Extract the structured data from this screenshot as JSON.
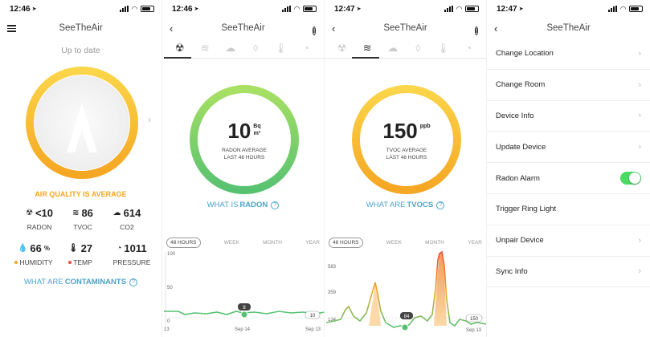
{
  "screen1": {
    "time": "12:46",
    "title": "SeeTheAir",
    "status_text": "Up to date",
    "air_quality_text": "AIR QUALITY IS AVERAGE",
    "metrics": [
      {
        "value": "<10",
        "unit": "",
        "label": "RADON"
      },
      {
        "value": "86",
        "unit": "",
        "label": "TVOC"
      },
      {
        "value": "614",
        "unit": "",
        "label": "CO2"
      },
      {
        "value": "66",
        "unit": "%",
        "label": "HUMIDITY"
      },
      {
        "value": "27",
        "unit": "",
        "label": "TEMP"
      },
      {
        "value": "1011",
        "unit": "",
        "label": "PRESSURE"
      }
    ],
    "what_are_prefix": "WHAT ARE",
    "what_are_bold": "CONTAMINANTS",
    "colors": {
      "accent": "#f5a623",
      "link": "#4aa3c9",
      "humidity_dot": "#f5a623",
      "temp_dot": "#e74c3c"
    }
  },
  "screen2": {
    "time": "12:46",
    "title": "SeeTheAir",
    "value": "10",
    "unit_top": "Bq",
    "unit_bottom": "m³",
    "sub1": "RADON AVERAGE",
    "sub2": "LAST 48 HOURS",
    "what_prefix": "WHAT IS",
    "what_bold": "RADON",
    "range_tabs": [
      "48 HOURS",
      "WEEK",
      "MONTH",
      "YEAR"
    ],
    "y_labels": [
      "100",
      "50",
      "0"
    ],
    "x_labels": [
      "13",
      "Sep 14",
      "Sep 13"
    ],
    "point_label_1": "8",
    "point_label_2": "10",
    "gauge_colors": [
      "#a8e063",
      "#56c271"
    ]
  },
  "screen3": {
    "time": "12:47",
    "title": "SeeTheAir",
    "value": "150",
    "unit_top": "ppb",
    "sub1": "TVOC AVERAGE",
    "sub2": "LAST 48 HOURS",
    "what_prefix": "WHAT ARE",
    "what_bold": "TVOCS",
    "range_tabs": [
      "48 HOURS",
      "WEEK",
      "MONTH",
      "YEAR"
    ],
    "y_labels": [
      "583",
      "359",
      "134"
    ],
    "x_labels": [
      "Sep 13"
    ],
    "point_label_1": "84",
    "point_label_2": "150",
    "gauge_colors": [
      "#fbd54a",
      "#f5a623"
    ]
  },
  "screen4": {
    "time": "12:47",
    "title": "SeeTheAir",
    "rows": [
      {
        "label": "Change Location"
      },
      {
        "label": "Change Room"
      },
      {
        "label": "Device Info"
      },
      {
        "label": "Update Device"
      },
      {
        "label": "Radon Alarm"
      },
      {
        "label": "Trigger Ring Light"
      },
      {
        "label": "Unpair Device"
      },
      {
        "label": "Sync Info"
      }
    ]
  }
}
